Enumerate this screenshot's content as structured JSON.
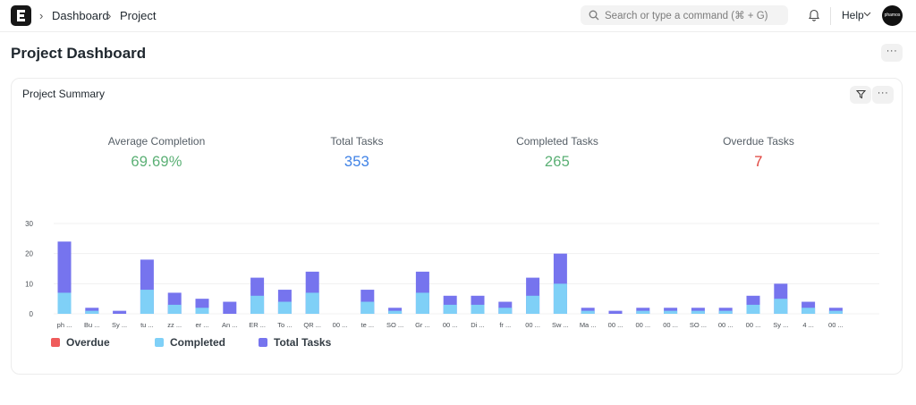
{
  "nav": {
    "breadcrumbs": [
      "Dashboard",
      "Project"
    ],
    "search_placeholder": "Search or type a command (⌘ + G)",
    "help_label": "Help",
    "avatar_text": "phamos"
  },
  "page": {
    "title": "Project Dashboard",
    "menu_label": "···"
  },
  "card": {
    "title": "Project Summary",
    "filter_icon": "filter-icon",
    "menu_label": "···"
  },
  "stats": [
    {
      "label": "Average Completion",
      "value": "69.69%",
      "color": "#5bb075"
    },
    {
      "label": "Total Tasks",
      "value": "353",
      "color": "#3f82e6"
    },
    {
      "label": "Completed Tasks",
      "value": "265",
      "color": "#5bb075"
    },
    {
      "label": "Overdue Tasks",
      "value": "7",
      "color": "#e0413a"
    }
  ],
  "legend": [
    {
      "label": "Overdue",
      "color": "#ef5b5b"
    },
    {
      "label": "Completed",
      "color": "#7fd0f7"
    },
    {
      "label": "Total Tasks",
      "color": "#7674ee"
    }
  ],
  "chart_data": {
    "type": "bar",
    "categories": [
      "ph ...",
      "Bu ...",
      "Sy ...",
      "tu ...",
      "zz ...",
      "er ...",
      "An ...",
      "ER ...",
      "To ...",
      "QR ...",
      "00 ...",
      "te ...",
      "SO ...",
      "Gr ...",
      "00 ...",
      "Di ...",
      "fr ...",
      "00 ...",
      "Sw ...",
      "Ma ...",
      "00 ...",
      "00 ...",
      "00 ...",
      "SO ...",
      "00 ...",
      "00 ...",
      "Sy ...",
      "4 ...",
      "00 ..."
    ],
    "series": [
      {
        "name": "Overdue",
        "values": [
          0,
          0,
          0,
          0,
          0,
          0,
          0,
          0,
          0,
          0,
          0,
          0,
          0,
          0,
          0,
          0,
          0,
          0,
          0,
          0,
          0,
          0,
          0,
          0,
          0,
          0,
          0,
          0,
          0
        ]
      },
      {
        "name": "Completed",
        "values": [
          7,
          1,
          0,
          8,
          3,
          2,
          0,
          6,
          4,
          7,
          0,
          4,
          1,
          7,
          3,
          3,
          2,
          6,
          10,
          1,
          0,
          1,
          1,
          1,
          1,
          3,
          5,
          2,
          1
        ]
      },
      {
        "name": "Total Tasks",
        "values": [
          24,
          2,
          1,
          18,
          7,
          5,
          4,
          12,
          8,
          14,
          0,
          8,
          2,
          14,
          6,
          6,
          4,
          12,
          20,
          2,
          1,
          2,
          2,
          2,
          2,
          6,
          10,
          4,
          2
        ]
      }
    ],
    "stacked": true,
    "yticks": [
      0,
      10,
      20,
      30
    ],
    "ylim": [
      0,
      30
    ],
    "grid": true,
    "legend_position": "bottom-left"
  }
}
